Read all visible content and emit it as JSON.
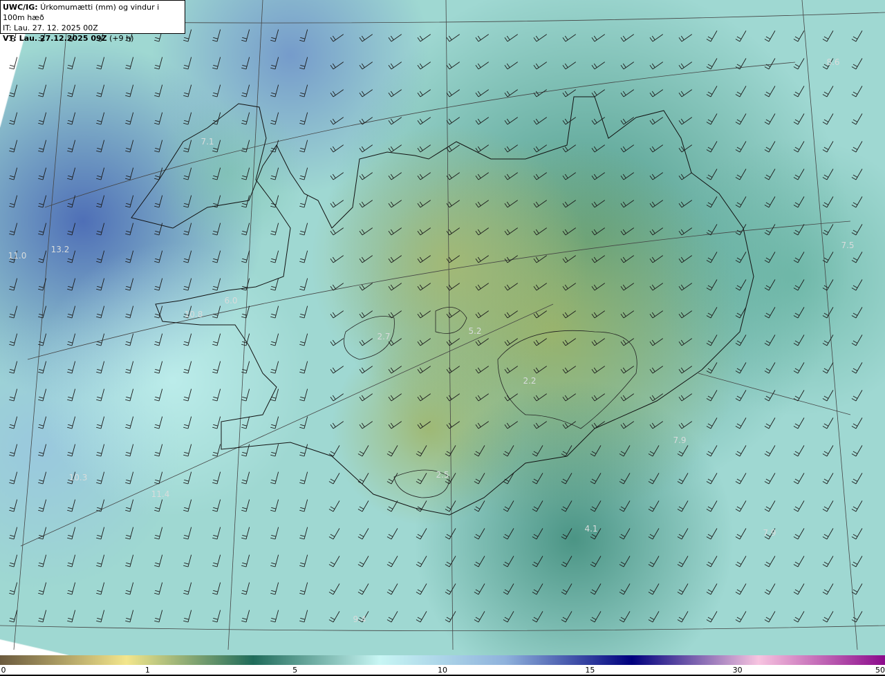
{
  "header": {
    "model": "UWC/IG:",
    "title": "Úrkomumætti (mm) og vindur i 100m hæð",
    "init_time": "IT: Lau. 27. 12. 2025 00Z",
    "valid_time": "VT: Lau. 27.12.2025 09Z",
    "lead": "(+9 h)"
  },
  "value_labels": [
    {
      "text": "13.2",
      "value": 13.2
    },
    {
      "text": "11.0",
      "value": 11.0
    },
    {
      "text": "7.1",
      "value": 7.1
    },
    {
      "text": "6.0",
      "value": 6.0
    },
    {
      "text": "10.8",
      "value": 10.8
    },
    {
      "text": "2.7",
      "value": 2.7
    },
    {
      "text": "5.2",
      "value": 5.2
    },
    {
      "text": "2.2",
      "value": 2.2
    },
    {
      "text": "7.9",
      "value": 7.9
    },
    {
      "text": "2.5",
      "value": 2.5
    },
    {
      "text": "10.3",
      "value": 10.3
    },
    {
      "text": "11.4",
      "value": 11.4
    },
    {
      "text": "4.1",
      "value": 4.1
    },
    {
      "text": "7.9",
      "value": 7.9
    },
    {
      "text": "9.4",
      "value": 9.4
    },
    {
      "text": "7.5",
      "value": 7.5
    },
    {
      "text": "8.6",
      "value": 8.6
    }
  ],
  "colorbar": {
    "ticks": [
      "0",
      "1",
      "5",
      "10",
      "15",
      "30",
      "50"
    ],
    "colors": [
      "#6b5a3e",
      "#f3e68c",
      "#1f6b5a",
      "#c8f6f4",
      "#8fb2dc",
      "#00007e",
      "#f7c4e0",
      "#8b0a8b"
    ]
  }
}
